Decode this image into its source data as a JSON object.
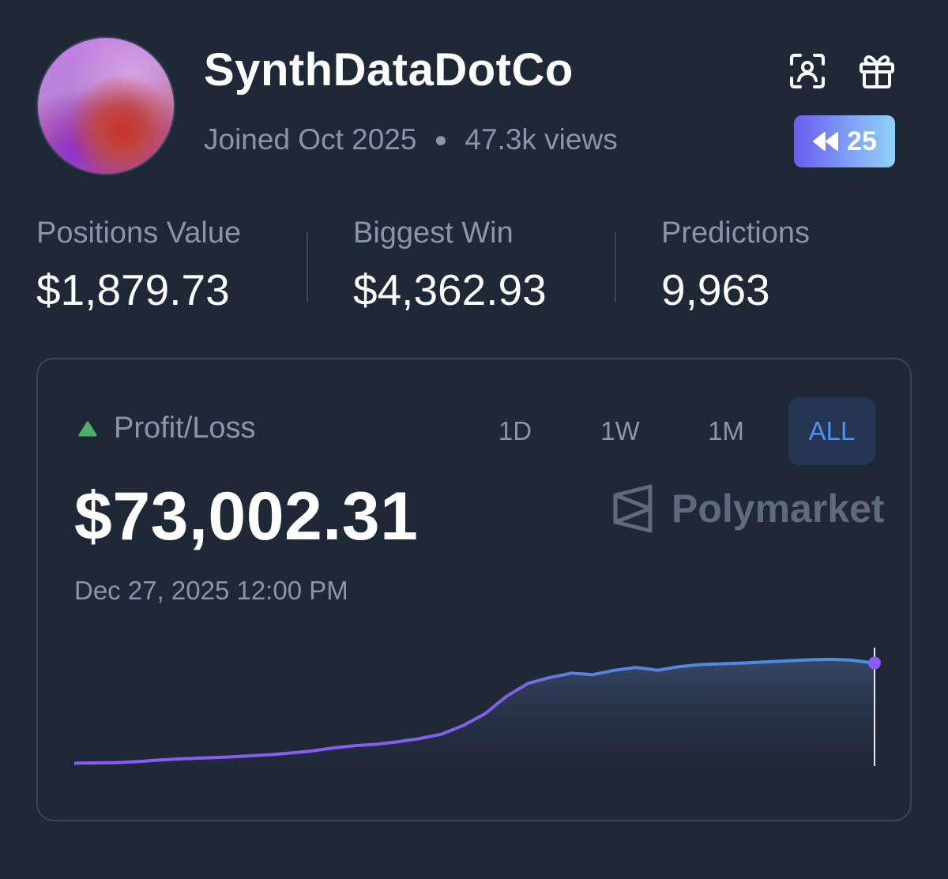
{
  "profile": {
    "username": "SynthDataDotCo",
    "joined": "Joined Oct 2025",
    "views": "47.3k views",
    "badge_count": "25"
  },
  "icons": {
    "scan": "face-scan-icon",
    "gift": "gift-icon",
    "rewind": "rewind-icon",
    "profit_indicator": "triangle-up-icon",
    "brand_logo": "polymarket-logo-icon"
  },
  "stats": [
    {
      "label": "Positions Value",
      "value": "$1,879.73"
    },
    {
      "label": "Biggest Win",
      "value": "$4,362.93"
    },
    {
      "label": "Predictions",
      "value": "9,963"
    }
  ],
  "pnl": {
    "title": "Profit/Loss",
    "value": "$73,002.31",
    "date": "Dec 27, 2025 12:00 PM",
    "brand": "Polymarket",
    "ranges": [
      "1D",
      "1W",
      "1M",
      "ALL"
    ],
    "selected_range": "ALL"
  },
  "colors": {
    "background": "#1e2837",
    "accent_blue": "#4f8fe8",
    "positive_green": "#4caf6a",
    "line_start": "#8b5cf6",
    "line_end": "#4a90e2"
  },
  "chart_data": {
    "type": "area",
    "title": "",
    "xlabel": "",
    "ylabel": "",
    "grid": false,
    "ylim": [
      0,
      80000
    ],
    "series": [
      {
        "values": [
          2000,
          2200,
          2400,
          3100,
          4200,
          5000,
          5600,
          6100,
          6900,
          7800,
          9000,
          10400,
          12500,
          14100,
          15000,
          16800,
          19000,
          22000,
          28000,
          36000,
          48000,
          57000,
          61000,
          64000,
          63000,
          66000,
          68000,
          66000,
          68500,
          70000,
          70500,
          71000,
          71800,
          72500,
          73200,
          73500,
          73000,
          71000
        ]
      }
    ]
  }
}
